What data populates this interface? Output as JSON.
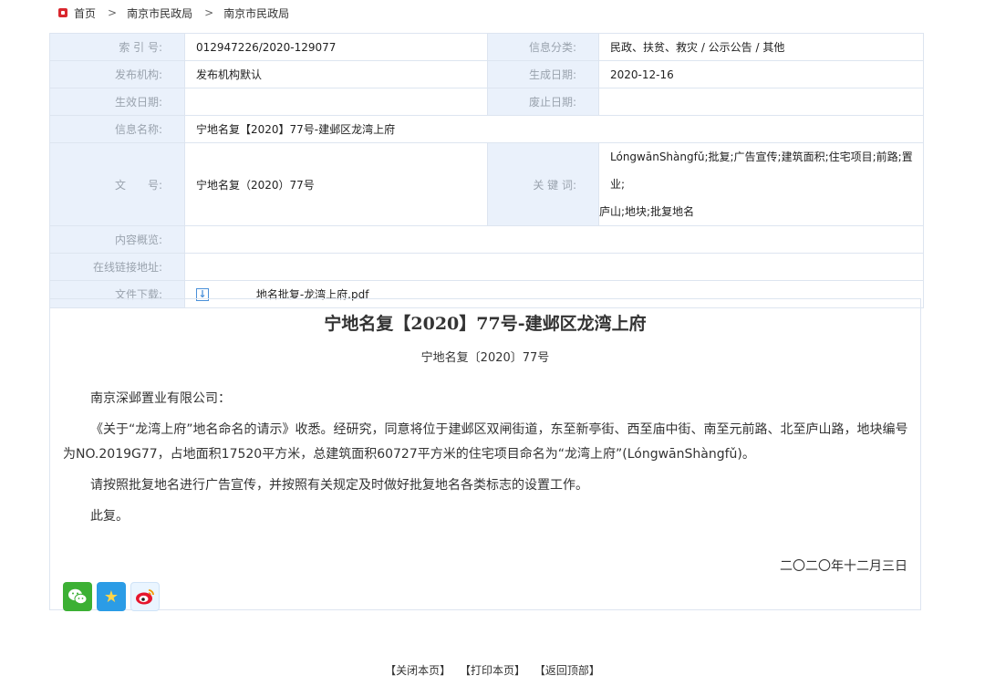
{
  "breadcrumb": {
    "home": "首页",
    "items": [
      "南京市民政局",
      "南京市民政局"
    ],
    "separator": ">"
  },
  "meta": {
    "index_label": "索 引 号:",
    "index_value": "012947226/2020-129077",
    "category_label": "信息分类:",
    "category_value": "民政、扶贫、救灾 / 公示公告 / 其他",
    "publisher_label": "发布机构:",
    "publisher_value": "发布机构默认",
    "created_label": "生成日期:",
    "created_value": "2020-12-16",
    "effective_label": "生效日期:",
    "effective_value": "",
    "expired_label": "废止日期:",
    "expired_value": "",
    "name_label": "信息名称:",
    "name_value": "宁地名复【2020】77号-建邺区龙湾上府",
    "docno_label": "文　　号:",
    "docno_value": "宁地名复（2020）77号",
    "keywords_label": "关 键 词:",
    "keywords_line1": "LóngwānShàngfǔ;批复;广告宣传;建筑面积;住宅项目;前路;置业;",
    "keywords_line2": "庐山;地块;批复地名",
    "summary_label": "内容概览:",
    "summary_value": "",
    "link_label": "在线链接地址:",
    "link_value": "",
    "download_label": "文件下载:",
    "download_file": "地名批复-龙湾上府.pdf"
  },
  "article": {
    "title": "宁地名复【2020】77号-建邺区龙湾上府",
    "doc_no": "宁地名复〔2020〕77号",
    "salutation": "南京深邺置业有限公司：",
    "paragraph1": "《关于“龙湾上府”地名命名的请示》收悉。经研究，同意将位于建邺区双闸街道，东至新亭街、西至庙中街、南至元前路、北至庐山路，地块编号为NO.2019G77，占地面积17520平方米，总建筑面积60727平方米的住宅项目命名为“龙湾上府”(LóngwānShàngfǔ)。",
    "paragraph2": "请按照批复地名进行广告宣传，并按照有关规定及时做好批复地名各类标志的设置工作。",
    "closing": "此复。",
    "date": "二〇二〇年十二月三日"
  },
  "share": {
    "icons": [
      "wechat-icon",
      "qzone-icon",
      "weibo-icon"
    ]
  },
  "footer": {
    "close": "【关闭本页】",
    "print": "【打印本页】",
    "top": "【返回顶部】"
  },
  "colors": {
    "label_bg": "#eaf1fb",
    "border": "#dde5f0",
    "label_text": "#9aa3ae",
    "home_icon": "#d9272e"
  }
}
